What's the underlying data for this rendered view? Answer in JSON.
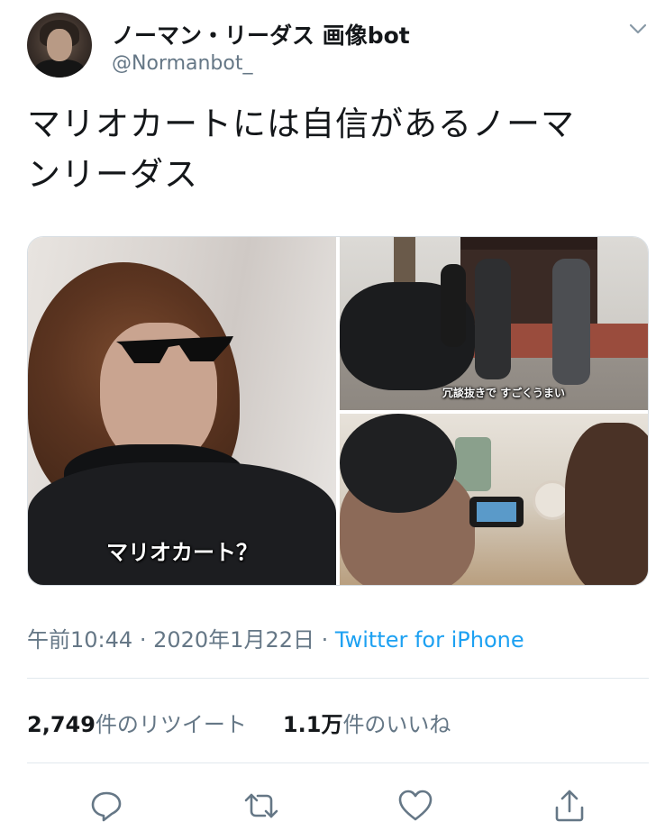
{
  "tweet": {
    "author_name": "ノーマン・リーダス 画像bot",
    "author_handle": "@Normanbot_",
    "text_line1": "マリオカートには自信があるノーマ",
    "text_line2": "ンリーダス",
    "media_captions": {
      "left": "マリオカート？",
      "top_right": "冗談抜きで すごくうまい"
    },
    "time": "午前10:44",
    "separator1": "·",
    "date": "2020年1月22日",
    "separator2": "·",
    "source": "Twitter for iPhone",
    "retweet_count": "2,749",
    "retweet_label": "件のリツイート",
    "like_count": "1.1万",
    "like_label": "件のいいね"
  },
  "icons": {
    "menu": "chevron-down-icon",
    "reply": "reply-icon",
    "retweet": "retweet-icon",
    "like": "heart-icon",
    "share": "share-icon"
  },
  "colors": {
    "text_primary": "#14171a",
    "text_secondary": "#657786",
    "link": "#1da1f2",
    "divider": "#e1e8ed"
  }
}
